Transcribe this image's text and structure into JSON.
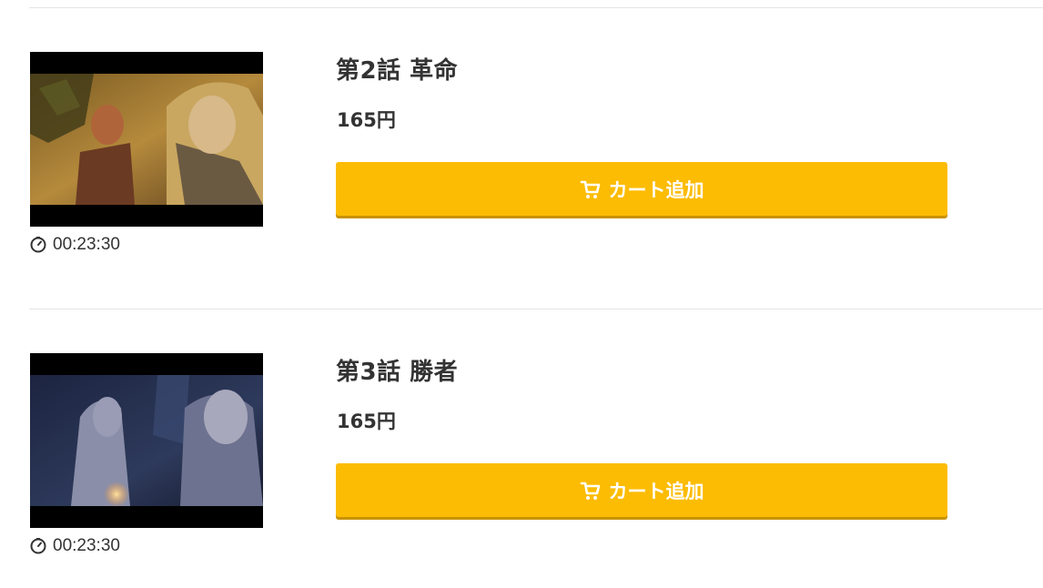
{
  "episodes": [
    {
      "title": "第2話 革命",
      "price": "165円",
      "duration": "00:23:30",
      "cart_label": "カート追加"
    },
    {
      "title": "第3話 勝者",
      "price": "165円",
      "duration": "00:23:30",
      "cart_label": "カート追加"
    }
  ],
  "colors": {
    "button": "#fcbc03",
    "button_shadow": "#c89300",
    "text": "#333333",
    "divider": "#e4e4e4"
  },
  "icons": {
    "duration": "clock-icon",
    "cart": "cart-icon"
  }
}
